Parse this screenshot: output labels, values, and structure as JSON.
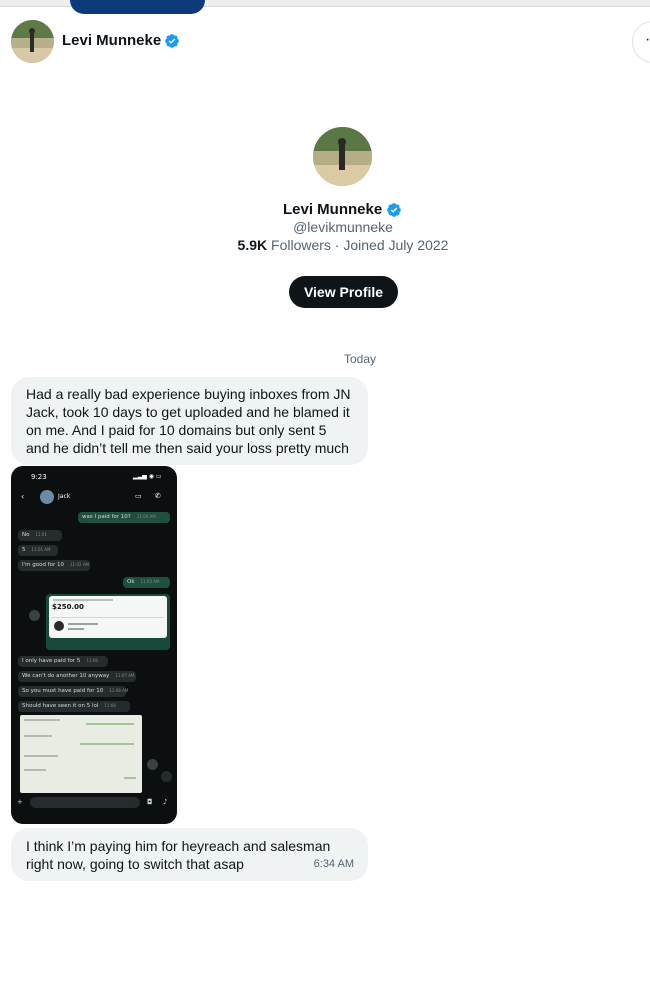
{
  "header": {
    "name": "Levi Munneke",
    "more_icon": "more-horizontal-icon"
  },
  "profile": {
    "name": "Levi Munneke",
    "handle": "@levikmunneke",
    "followers_count": "5.9K",
    "followers_label": "Followers",
    "separator": " · ",
    "joined": "Joined July 2022",
    "view_profile_label": "View Profile"
  },
  "conversation": {
    "date_separator": "Today",
    "messages": [
      {
        "text": "Had a really bad experience buying inboxes from JN Jack, took 10 days to get uploaded and he blamed it on me. And I paid for 10 domains but only sent 5 and he didn’t tell me then said your loss pretty much"
      },
      {
        "text": "I think I’m paying him for heyreach and salesman right now, going to switch that asap",
        "time": "6:34 AM"
      }
    ]
  },
  "attachment": {
    "status_time": "9:23",
    "contact": "Jack",
    "chat": [
      {
        "dir": "out",
        "text": "was I paid for 10?",
        "meta": "11:00 AM"
      },
      {
        "dir": "in",
        "text": "No",
        "meta": "11:01"
      },
      {
        "dir": "in",
        "text": "5",
        "meta": "11:01 AM"
      },
      {
        "dir": "in",
        "text": "I'm good for 10",
        "meta": "11:02 AM"
      },
      {
        "dir": "out",
        "text": "Ok",
        "meta": "11:03 AM"
      },
      {
        "dir": "in",
        "text": "I only have paid for 5",
        "meta": "11:06"
      },
      {
        "dir": "in",
        "text": "We can't do another 10 anyway",
        "meta": "11:07 AM"
      },
      {
        "dir": "in",
        "text": "So you must have paid for 10",
        "meta": "11:08 AM"
      },
      {
        "dir": "in",
        "text": "Should have seen it on 5 lol",
        "meta": "11:09"
      }
    ],
    "payment_amount": "$250.00"
  },
  "colors": {
    "verified": "#1d9bf0",
    "bubble": "#eff3f4",
    "button": "#0f1419",
    "muted": "#536471"
  }
}
